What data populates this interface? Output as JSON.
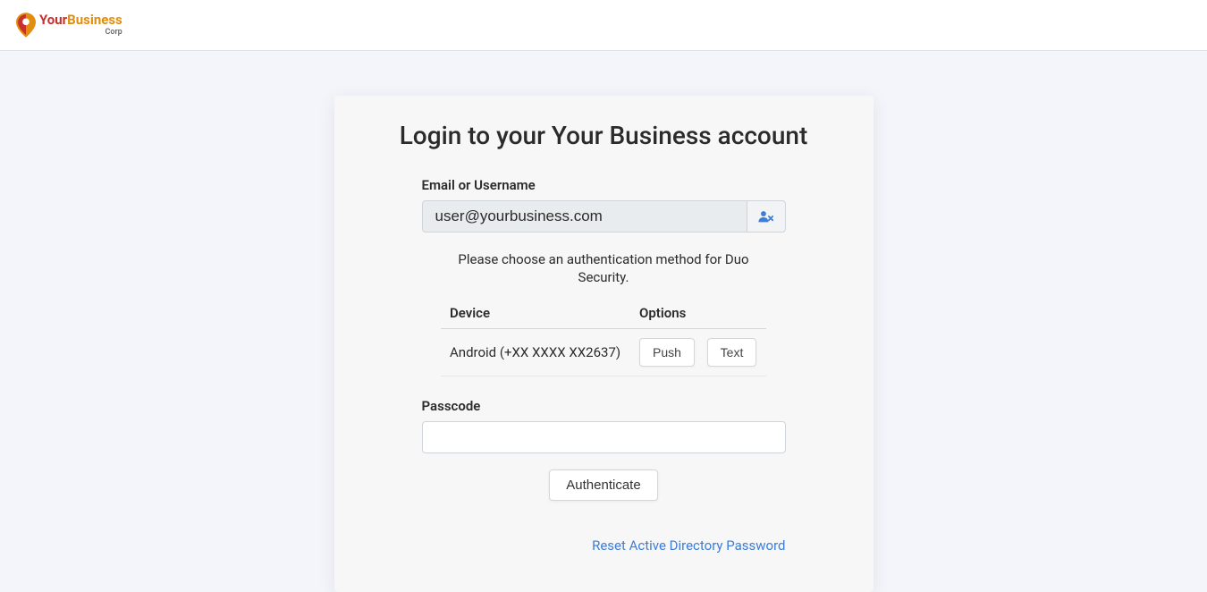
{
  "brand": {
    "name_part1": "Your",
    "name_part2": "Business",
    "sub": "Corp"
  },
  "card": {
    "title": "Login to your Your Business account"
  },
  "form": {
    "email_label": "Email or Username",
    "email_value": "user@yourbusiness.com",
    "help_text": "Please choose an authentication method for Duo Security.",
    "passcode_label": "Passcode",
    "passcode_value": "",
    "auth_button": "Authenticate",
    "reset_link": "Reset Active Directory Password"
  },
  "device_table": {
    "header_device": "Device",
    "header_options": "Options",
    "row": {
      "device": "Android (+XX XXXX XX2637)",
      "push_btn": "Push",
      "text_btn": "Text"
    }
  }
}
